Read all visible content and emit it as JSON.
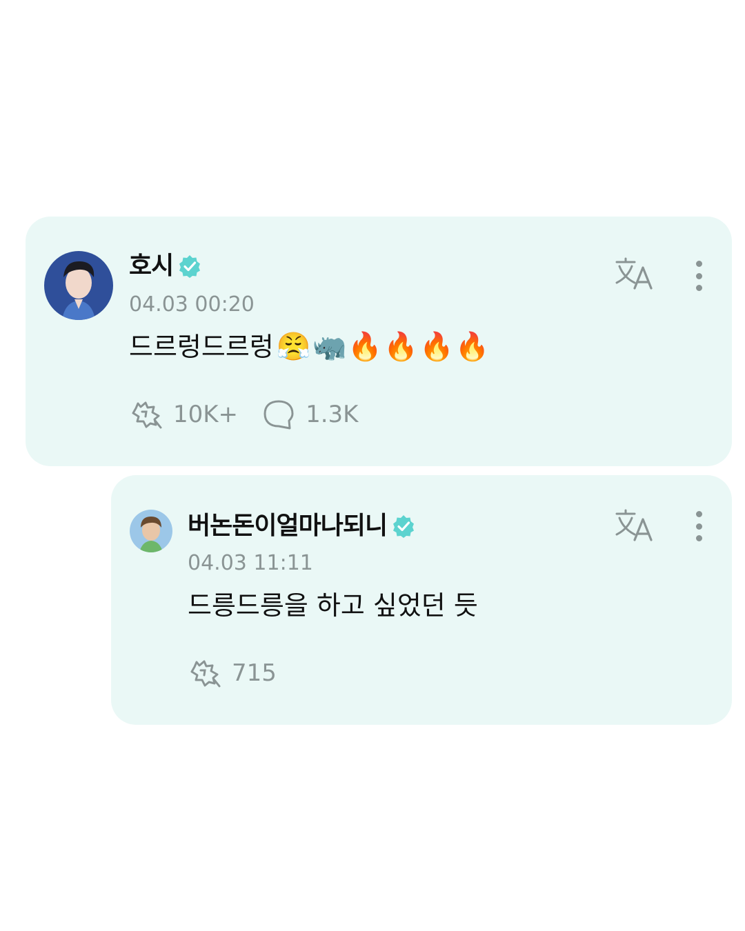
{
  "post": {
    "username": "호시",
    "timestamp": "04.03 00:20",
    "text": "드르렁드르렁",
    "emojis": "😤🦏🔥🔥🔥🔥",
    "cheers_count": "10K+",
    "comments_count": "1.3K",
    "icons": {
      "verified": "verified-badge-icon",
      "translate": "translate-icon",
      "more": "more-vertical-icon",
      "cheers": "cheers-icon",
      "comment": "comment-bubble-icon"
    }
  },
  "reply": {
    "username": "버논돈이얼마나되니",
    "timestamp": "04.03 11:11",
    "text": "드릉드릉을 하고 싶었던 듯",
    "cheers_count": "715"
  },
  "colors": {
    "card_background": "#eaf8f6",
    "verified": "#5cd3cf",
    "muted_text": "#8a9494",
    "primary_text": "#111111"
  }
}
